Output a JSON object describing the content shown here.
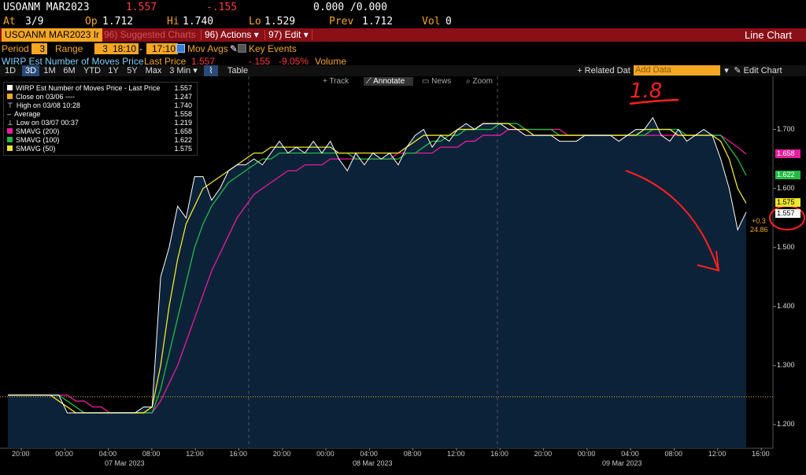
{
  "header": {
    "ticker": "USOANM MAR2023",
    "last": "1.557",
    "change": "-.155",
    "bidask": "0.000 /0.000",
    "at_label": "At",
    "at": "3/9",
    "op_label": "Op",
    "op": "1.712",
    "hi_label": "Hi",
    "hi": "1.740",
    "lo_label": "Lo",
    "lo": "1.529",
    "prev_label": "Prev",
    "prev": "1.712",
    "vol_label": "Vol",
    "vol": "0"
  },
  "toolbar": {
    "ticker_tab": "USOANM MAR2023 Ir",
    "suggested": "96) Suggested Charts",
    "actions": "96) Actions ▾",
    "edit": "97) Edit ▾",
    "title": "Line Chart"
  },
  "options": {
    "period_label": "Period",
    "period_value": "3",
    "range_label": "Range",
    "range_value": "3",
    "start_time": "18:10",
    "dash": "-",
    "end_time": "17:10",
    "mov_avgs": "Mov Avgs",
    "key_events": "Key Events"
  },
  "series_line": {
    "name": "WIRP Est Number of Moves Price",
    "last_label": "Last Price",
    "last": "1.557",
    "change": "-.155",
    "pct": "-9.05%",
    "volume": "Volume"
  },
  "tabs": [
    "1D",
    "3D",
    "1M",
    "6M",
    "YTD",
    "1Y",
    "5Y",
    "Max",
    "3 Min ▾",
    "Table"
  ],
  "selected_tab": "3D",
  "right_tools": {
    "related": "+ Related Dat",
    "add_placeholder": "Add Data",
    "edit_chart": "✎ Edit Chart"
  },
  "chart_tools": [
    "Track",
    "Annotate",
    "News",
    "Zoom"
  ],
  "legend": [
    {
      "label": "WIRP Est Number of Moves Price - Last Price",
      "value": "1.557",
      "color": "#ffffff"
    },
    {
      "label": "Close on 03/06 ----",
      "value": "1.247",
      "color": "#f5a623"
    },
    {
      "label": "High on 03/08 10:28",
      "value": "1.740",
      "color": "#888888"
    },
    {
      "label": "Average",
      "value": "1.558",
      "color": "#888888"
    },
    {
      "label": "Low on 03/07 00:37",
      "value": "1.219",
      "color": "#888888"
    },
    {
      "label": "SMAVG (200)",
      "value": "1.658",
      "color": "#e81c9c"
    },
    {
      "label": "SMAVG (100)",
      "value": "1.622",
      "color": "#22bb44"
    },
    {
      "label": "SMAVG (50)",
      "value": "1.575",
      "color": "#f0e62a"
    }
  ],
  "annotations": {
    "handwritten": "1.8",
    "right_small_1": "+0.3",
    "right_small_2": "24.86"
  },
  "chart_data": {
    "type": "line",
    "ylim": [
      1.16,
      1.79
    ],
    "yticks": [
      "1.700",
      "1.600",
      "1.500",
      "1.400",
      "1.300",
      "1.200"
    ],
    "ytick_values": [
      1.7,
      1.6,
      1.5,
      1.4,
      1.3,
      1.2
    ],
    "xticks": [
      "20:00",
      "00:00",
      "04:00",
      "08:00",
      "12:00",
      "16:00",
      "20:00",
      "00:00",
      "04:00",
      "08:00",
      "12:00",
      "16:00",
      "20:00",
      "00:00",
      "04:00",
      "08:00",
      "12:00",
      "16:00"
    ],
    "date_labels": [
      "07 Mar 2023",
      "08 Mar 2023",
      "09 Mar 2023"
    ],
    "close_ref": 1.247,
    "tags": [
      {
        "value": 1.658,
        "label": "1.658",
        "color": "#e81c9c"
      },
      {
        "value": 1.622,
        "label": "1.622",
        "color": "#22bb44"
      },
      {
        "value": 1.575,
        "label": "1.575",
        "color": "#f0e62a"
      },
      {
        "value": 1.557,
        "label": "1.557",
        "color": "#ffffff"
      }
    ],
    "series": [
      {
        "name": "WIRP Est Number of Moves Price - Last Price",
        "color": "#ffffff",
        "values": [
          1.25,
          1.25,
          1.25,
          1.25,
          1.25,
          1.25,
          1.25,
          1.22,
          1.22,
          1.22,
          1.22,
          1.22,
          1.22,
          1.22,
          1.22,
          1.22,
          1.23,
          1.23,
          1.45,
          1.5,
          1.57,
          1.55,
          1.62,
          1.62,
          1.58,
          1.6,
          1.63,
          1.64,
          1.64,
          1.65,
          1.64,
          1.66,
          1.68,
          1.66,
          1.67,
          1.66,
          1.68,
          1.66,
          1.68,
          1.65,
          1.63,
          1.66,
          1.64,
          1.66,
          1.65,
          1.66,
          1.64,
          1.67,
          1.69,
          1.7,
          1.67,
          1.69,
          1.68,
          1.7,
          1.71,
          1.7,
          1.71,
          1.71,
          1.71,
          1.7,
          1.7,
          1.69,
          1.69,
          1.69,
          1.69,
          1.68,
          1.68,
          1.68,
          1.69,
          1.69,
          1.69,
          1.69,
          1.68,
          1.69,
          1.7,
          1.7,
          1.72,
          1.69,
          1.68,
          1.7,
          1.68,
          1.69,
          1.7,
          1.69,
          1.65,
          1.6,
          1.53,
          1.56
        ]
      },
      {
        "name": "SMAVG (50)",
        "color": "#f0e62a",
        "values": [
          1.25,
          1.25,
          1.25,
          1.25,
          1.25,
          1.25,
          1.24,
          1.23,
          1.22,
          1.22,
          1.22,
          1.22,
          1.22,
          1.22,
          1.22,
          1.22,
          1.22,
          1.23,
          1.3,
          1.4,
          1.48,
          1.54,
          1.57,
          1.6,
          1.61,
          1.62,
          1.63,
          1.64,
          1.65,
          1.66,
          1.66,
          1.67,
          1.67,
          1.67,
          1.67,
          1.67,
          1.67,
          1.67,
          1.67,
          1.66,
          1.66,
          1.66,
          1.66,
          1.66,
          1.66,
          1.66,
          1.66,
          1.67,
          1.68,
          1.69,
          1.69,
          1.69,
          1.69,
          1.7,
          1.7,
          1.7,
          1.71,
          1.71,
          1.71,
          1.71,
          1.7,
          1.7,
          1.69,
          1.69,
          1.69,
          1.69,
          1.69,
          1.69,
          1.69,
          1.69,
          1.69,
          1.69,
          1.69,
          1.69,
          1.69,
          1.7,
          1.7,
          1.7,
          1.7,
          1.69,
          1.69,
          1.69,
          1.69,
          1.69,
          1.68,
          1.65,
          1.6,
          1.575
        ]
      },
      {
        "name": "SMAVG (100)",
        "color": "#22bb44",
        "values": [
          1.25,
          1.25,
          1.25,
          1.25,
          1.25,
          1.25,
          1.25,
          1.24,
          1.23,
          1.22,
          1.22,
          1.22,
          1.22,
          1.22,
          1.22,
          1.22,
          1.22,
          1.22,
          1.26,
          1.32,
          1.38,
          1.44,
          1.5,
          1.54,
          1.57,
          1.59,
          1.61,
          1.62,
          1.63,
          1.64,
          1.65,
          1.65,
          1.66,
          1.66,
          1.66,
          1.66,
          1.66,
          1.66,
          1.66,
          1.66,
          1.66,
          1.65,
          1.65,
          1.65,
          1.65,
          1.65,
          1.65,
          1.66,
          1.66,
          1.67,
          1.68,
          1.68,
          1.69,
          1.69,
          1.7,
          1.7,
          1.7,
          1.7,
          1.71,
          1.71,
          1.71,
          1.7,
          1.7,
          1.7,
          1.7,
          1.69,
          1.69,
          1.69,
          1.69,
          1.69,
          1.69,
          1.69,
          1.69,
          1.69,
          1.69,
          1.69,
          1.7,
          1.7,
          1.7,
          1.7,
          1.69,
          1.69,
          1.69,
          1.69,
          1.69,
          1.67,
          1.65,
          1.622
        ]
      },
      {
        "name": "SMAVG (200)",
        "color": "#e81c9c",
        "values": [
          1.25,
          1.25,
          1.25,
          1.25,
          1.25,
          1.25,
          1.25,
          1.25,
          1.24,
          1.24,
          1.23,
          1.23,
          1.22,
          1.22,
          1.22,
          1.22,
          1.22,
          1.22,
          1.24,
          1.27,
          1.3,
          1.34,
          1.38,
          1.42,
          1.46,
          1.49,
          1.52,
          1.55,
          1.57,
          1.59,
          1.6,
          1.61,
          1.62,
          1.63,
          1.63,
          1.64,
          1.64,
          1.64,
          1.65,
          1.65,
          1.65,
          1.65,
          1.65,
          1.65,
          1.65,
          1.65,
          1.66,
          1.66,
          1.66,
          1.66,
          1.66,
          1.67,
          1.67,
          1.67,
          1.68,
          1.68,
          1.69,
          1.69,
          1.69,
          1.7,
          1.7,
          1.7,
          1.7,
          1.7,
          1.7,
          1.7,
          1.69,
          1.69,
          1.69,
          1.69,
          1.69,
          1.69,
          1.69,
          1.69,
          1.69,
          1.69,
          1.69,
          1.69,
          1.69,
          1.69,
          1.69,
          1.69,
          1.69,
          1.69,
          1.69,
          1.68,
          1.67,
          1.658
        ]
      }
    ]
  }
}
